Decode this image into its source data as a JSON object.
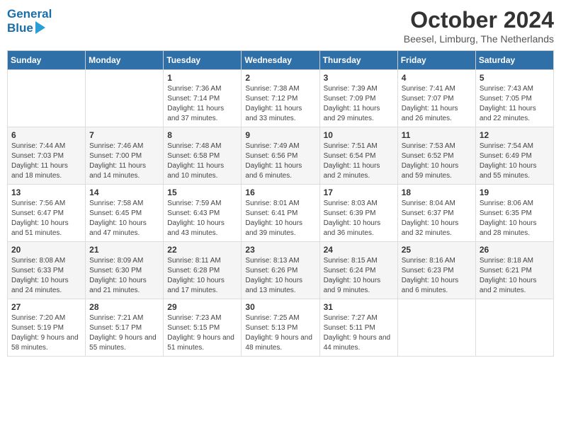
{
  "header": {
    "logo_line1": "General",
    "logo_line2": "Blue",
    "title": "October 2024",
    "location": "Beesel, Limburg, The Netherlands"
  },
  "days_of_week": [
    "Sunday",
    "Monday",
    "Tuesday",
    "Wednesday",
    "Thursday",
    "Friday",
    "Saturday"
  ],
  "weeks": [
    [
      {
        "day": "",
        "content": ""
      },
      {
        "day": "",
        "content": ""
      },
      {
        "day": "1",
        "content": "Sunrise: 7:36 AM\nSunset: 7:14 PM\nDaylight: 11 hours and 37 minutes."
      },
      {
        "day": "2",
        "content": "Sunrise: 7:38 AM\nSunset: 7:12 PM\nDaylight: 11 hours and 33 minutes."
      },
      {
        "day": "3",
        "content": "Sunrise: 7:39 AM\nSunset: 7:09 PM\nDaylight: 11 hours and 29 minutes."
      },
      {
        "day": "4",
        "content": "Sunrise: 7:41 AM\nSunset: 7:07 PM\nDaylight: 11 hours and 26 minutes."
      },
      {
        "day": "5",
        "content": "Sunrise: 7:43 AM\nSunset: 7:05 PM\nDaylight: 11 hours and 22 minutes."
      }
    ],
    [
      {
        "day": "6",
        "content": "Sunrise: 7:44 AM\nSunset: 7:03 PM\nDaylight: 11 hours and 18 minutes."
      },
      {
        "day": "7",
        "content": "Sunrise: 7:46 AM\nSunset: 7:00 PM\nDaylight: 11 hours and 14 minutes."
      },
      {
        "day": "8",
        "content": "Sunrise: 7:48 AM\nSunset: 6:58 PM\nDaylight: 11 hours and 10 minutes."
      },
      {
        "day": "9",
        "content": "Sunrise: 7:49 AM\nSunset: 6:56 PM\nDaylight: 11 hours and 6 minutes."
      },
      {
        "day": "10",
        "content": "Sunrise: 7:51 AM\nSunset: 6:54 PM\nDaylight: 11 hours and 2 minutes."
      },
      {
        "day": "11",
        "content": "Sunrise: 7:53 AM\nSunset: 6:52 PM\nDaylight: 10 hours and 59 minutes."
      },
      {
        "day": "12",
        "content": "Sunrise: 7:54 AM\nSunset: 6:49 PM\nDaylight: 10 hours and 55 minutes."
      }
    ],
    [
      {
        "day": "13",
        "content": "Sunrise: 7:56 AM\nSunset: 6:47 PM\nDaylight: 10 hours and 51 minutes."
      },
      {
        "day": "14",
        "content": "Sunrise: 7:58 AM\nSunset: 6:45 PM\nDaylight: 10 hours and 47 minutes."
      },
      {
        "day": "15",
        "content": "Sunrise: 7:59 AM\nSunset: 6:43 PM\nDaylight: 10 hours and 43 minutes."
      },
      {
        "day": "16",
        "content": "Sunrise: 8:01 AM\nSunset: 6:41 PM\nDaylight: 10 hours and 39 minutes."
      },
      {
        "day": "17",
        "content": "Sunrise: 8:03 AM\nSunset: 6:39 PM\nDaylight: 10 hours and 36 minutes."
      },
      {
        "day": "18",
        "content": "Sunrise: 8:04 AM\nSunset: 6:37 PM\nDaylight: 10 hours and 32 minutes."
      },
      {
        "day": "19",
        "content": "Sunrise: 8:06 AM\nSunset: 6:35 PM\nDaylight: 10 hours and 28 minutes."
      }
    ],
    [
      {
        "day": "20",
        "content": "Sunrise: 8:08 AM\nSunset: 6:33 PM\nDaylight: 10 hours and 24 minutes."
      },
      {
        "day": "21",
        "content": "Sunrise: 8:09 AM\nSunset: 6:30 PM\nDaylight: 10 hours and 21 minutes."
      },
      {
        "day": "22",
        "content": "Sunrise: 8:11 AM\nSunset: 6:28 PM\nDaylight: 10 hours and 17 minutes."
      },
      {
        "day": "23",
        "content": "Sunrise: 8:13 AM\nSunset: 6:26 PM\nDaylight: 10 hours and 13 minutes."
      },
      {
        "day": "24",
        "content": "Sunrise: 8:15 AM\nSunset: 6:24 PM\nDaylight: 10 hours and 9 minutes."
      },
      {
        "day": "25",
        "content": "Sunrise: 8:16 AM\nSunset: 6:23 PM\nDaylight: 10 hours and 6 minutes."
      },
      {
        "day": "26",
        "content": "Sunrise: 8:18 AM\nSunset: 6:21 PM\nDaylight: 10 hours and 2 minutes."
      }
    ],
    [
      {
        "day": "27",
        "content": "Sunrise: 7:20 AM\nSunset: 5:19 PM\nDaylight: 9 hours and 58 minutes."
      },
      {
        "day": "28",
        "content": "Sunrise: 7:21 AM\nSunset: 5:17 PM\nDaylight: 9 hours and 55 minutes."
      },
      {
        "day": "29",
        "content": "Sunrise: 7:23 AM\nSunset: 5:15 PM\nDaylight: 9 hours and 51 minutes."
      },
      {
        "day": "30",
        "content": "Sunrise: 7:25 AM\nSunset: 5:13 PM\nDaylight: 9 hours and 48 minutes."
      },
      {
        "day": "31",
        "content": "Sunrise: 7:27 AM\nSunset: 5:11 PM\nDaylight: 9 hours and 44 minutes."
      },
      {
        "day": "",
        "content": ""
      },
      {
        "day": "",
        "content": ""
      }
    ]
  ]
}
